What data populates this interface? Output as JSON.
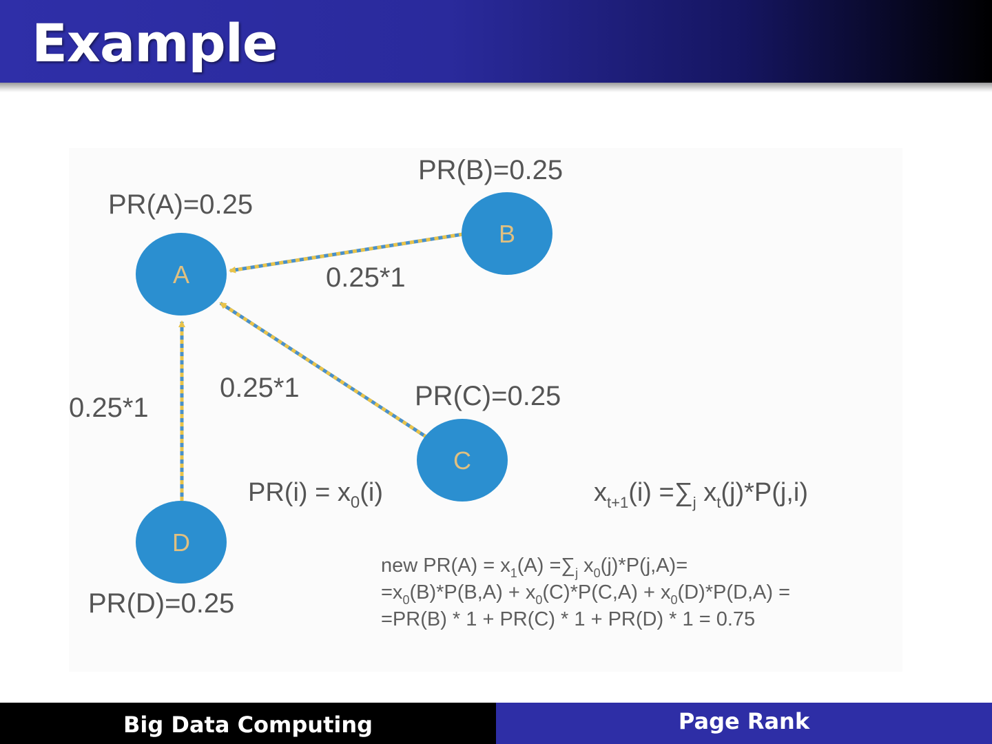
{
  "slide": {
    "title": "Example"
  },
  "graph": {
    "nodes": {
      "A": {
        "letter": "A",
        "pr_label": "PR(A)=0.25"
      },
      "B": {
        "letter": "B",
        "pr_label": "PR(B)=0.25"
      },
      "C": {
        "letter": "C",
        "pr_label": "PR(C)=0.25"
      },
      "D": {
        "letter": "D",
        "pr_label": "PR(D)=0.25"
      }
    },
    "edges": {
      "BA": "0.25*1",
      "CA": "0.25*1",
      "DA": "0.25*1"
    }
  },
  "formulas": {
    "init_lhs": "PR(i) = x",
    "init_sub": "0",
    "init_rhs": "(i)",
    "iter_x": "x",
    "iter_sub": "t+1",
    "iter_mid": "(i) =∑",
    "iter_sum_sub": "j",
    "iter_x2": " x",
    "iter_sub2": "t",
    "iter_end": "(j)*P(j,i)"
  },
  "calculation": {
    "l1_a": "new PR(A) = x",
    "l1_s1": "1",
    "l1_b": "(A) =∑",
    "l1_s2": "j",
    "l1_c": " x",
    "l1_s3": "0",
    "l1_d": "(j)*P(j,A)=",
    "l2_a": "=x",
    "l2_s1": "0",
    "l2_b": "(B)*P(B,A) + x",
    "l2_s2": "0",
    "l2_c": "(C)*P(C,A) + x",
    "l2_s3": "0",
    "l2_d": "(D)*P(D,A) =",
    "l3": "=PR(B) * 1 + PR(C) * 1  + PR(D) * 1 = 0.75"
  },
  "colors": {
    "node_fill": "#2b8fd0",
    "edge_blue": "#4a90c8",
    "edge_yellow": "#e8c34a"
  },
  "footer": {
    "left": "Big Data Computing",
    "right": "Page Rank"
  }
}
